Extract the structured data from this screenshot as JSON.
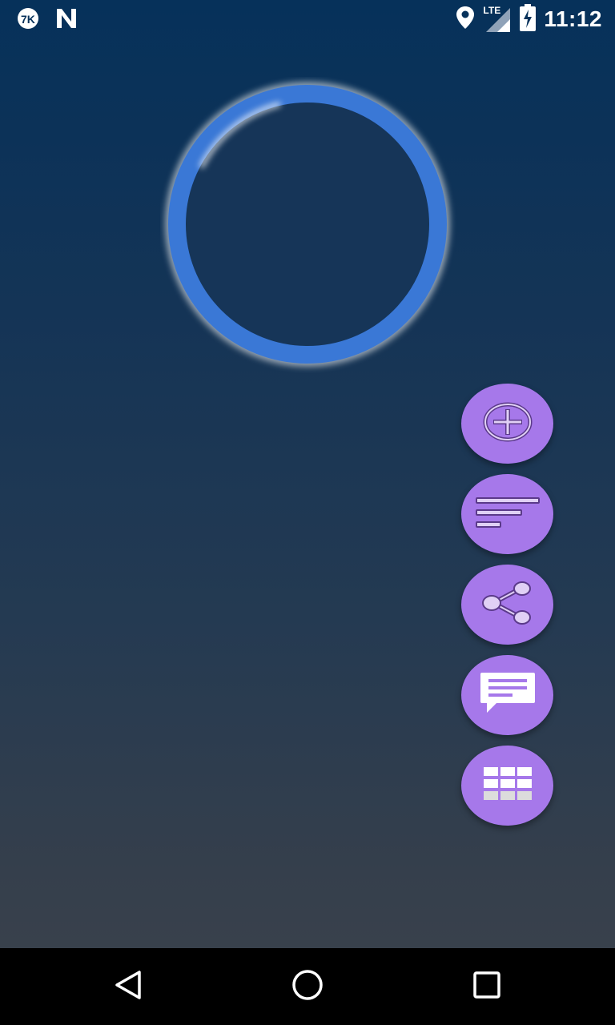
{
  "status_bar": {
    "time": "11:12",
    "network_label": "LTE",
    "icons": [
      "app-notification-icon",
      "n-notification-icon",
      "location-icon",
      "lte-signal-icon",
      "battery-charging-icon"
    ]
  },
  "progress_ring": {
    "color": "#3a78d6",
    "glow_color": "#ffffff"
  },
  "fab_menu": {
    "color": "#a678ea",
    "items": [
      {
        "icon": "add-circle-icon"
      },
      {
        "icon": "sort-lines-icon"
      },
      {
        "icon": "share-icon"
      },
      {
        "icon": "message-icon"
      },
      {
        "icon": "grid-apps-icon"
      }
    ]
  },
  "nav_bar": {
    "buttons": [
      "back-icon",
      "home-icon",
      "recents-icon"
    ]
  }
}
